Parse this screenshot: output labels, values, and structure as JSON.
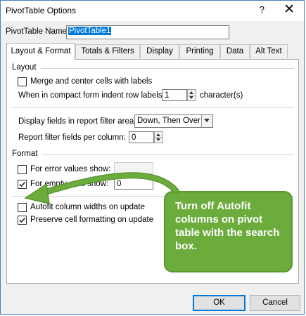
{
  "dialog": {
    "title": "PivotTable Options",
    "help_glyph": "?",
    "close_glyph": "✕",
    "name_label": "PivotTable Name:",
    "name_value": "PivotTable1"
  },
  "tabs": [
    {
      "label": "Layout & Format",
      "active": true
    },
    {
      "label": "Totals & Filters",
      "active": false
    },
    {
      "label": "Display",
      "active": false
    },
    {
      "label": "Printing",
      "active": false
    },
    {
      "label": "Data",
      "active": false
    },
    {
      "label": "Alt Text",
      "active": false
    }
  ],
  "layout": {
    "group_label": "Layout",
    "merge_label": "Merge and center cells with labels",
    "merge_checked": false,
    "indent_label": "When in compact form indent row labels:",
    "indent_value": "1",
    "indent_unit": "character(s)",
    "display_fields_label": "Display fields in report filter area:",
    "display_fields_value": "Down, Then Over",
    "filter_fields_label": "Report filter fields per column:",
    "filter_fields_value": "0"
  },
  "format": {
    "group_label": "Format",
    "error_label": "For error values show:",
    "error_checked": false,
    "error_value": "",
    "empty_label": "For empty cells show:",
    "empty_checked": true,
    "empty_value": "0",
    "autofit_label": "Autofit column widths on update",
    "autofit_checked": false,
    "preserve_label": "Preserve cell formatting on update",
    "preserve_checked": true
  },
  "buttons": {
    "ok_label": "OK",
    "cancel_label": "Cancel"
  },
  "callout": {
    "text": "Turn off Autofit columns on pivot table with the search box.",
    "color": "#6cac3d"
  },
  "colors": {
    "accent": "#0078d7",
    "border": "#4a7fc1"
  }
}
